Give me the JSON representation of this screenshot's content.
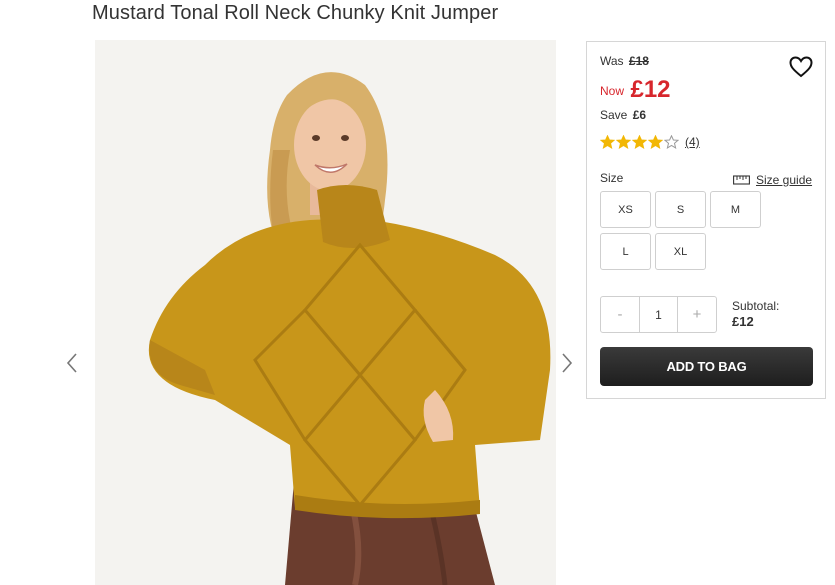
{
  "product": {
    "title": "Mustard Tonal Roll Neck Chunky Knit Jumper"
  },
  "pricing": {
    "was_label": "Was",
    "was_price": "£18",
    "now_label": "Now",
    "now_price": "£12",
    "save_label": "Save",
    "save_amount": "£6"
  },
  "rating": {
    "stars": 4,
    "max_stars": 5,
    "review_count": "(4)"
  },
  "size": {
    "label": "Size",
    "guide_label": "Size guide",
    "options": [
      "XS",
      "S",
      "M",
      "L",
      "XL"
    ]
  },
  "quantity": {
    "minus": "-",
    "value": "1",
    "plus": "+"
  },
  "subtotal": {
    "label": "Subtotal:",
    "value": "£12"
  },
  "add_to_bag_label": "ADD TO BAG",
  "icons": {
    "wishlist": "heart-icon",
    "size_guide": "ruler-icon",
    "prev": "chevron-left-icon",
    "next": "chevron-right-icon",
    "star": "star-icon"
  },
  "colors": {
    "sale_red": "#d7262c",
    "star_gold": "#f2b705",
    "button_dark": "#2b2b2b",
    "jumper_mustard": "#c8961a"
  }
}
